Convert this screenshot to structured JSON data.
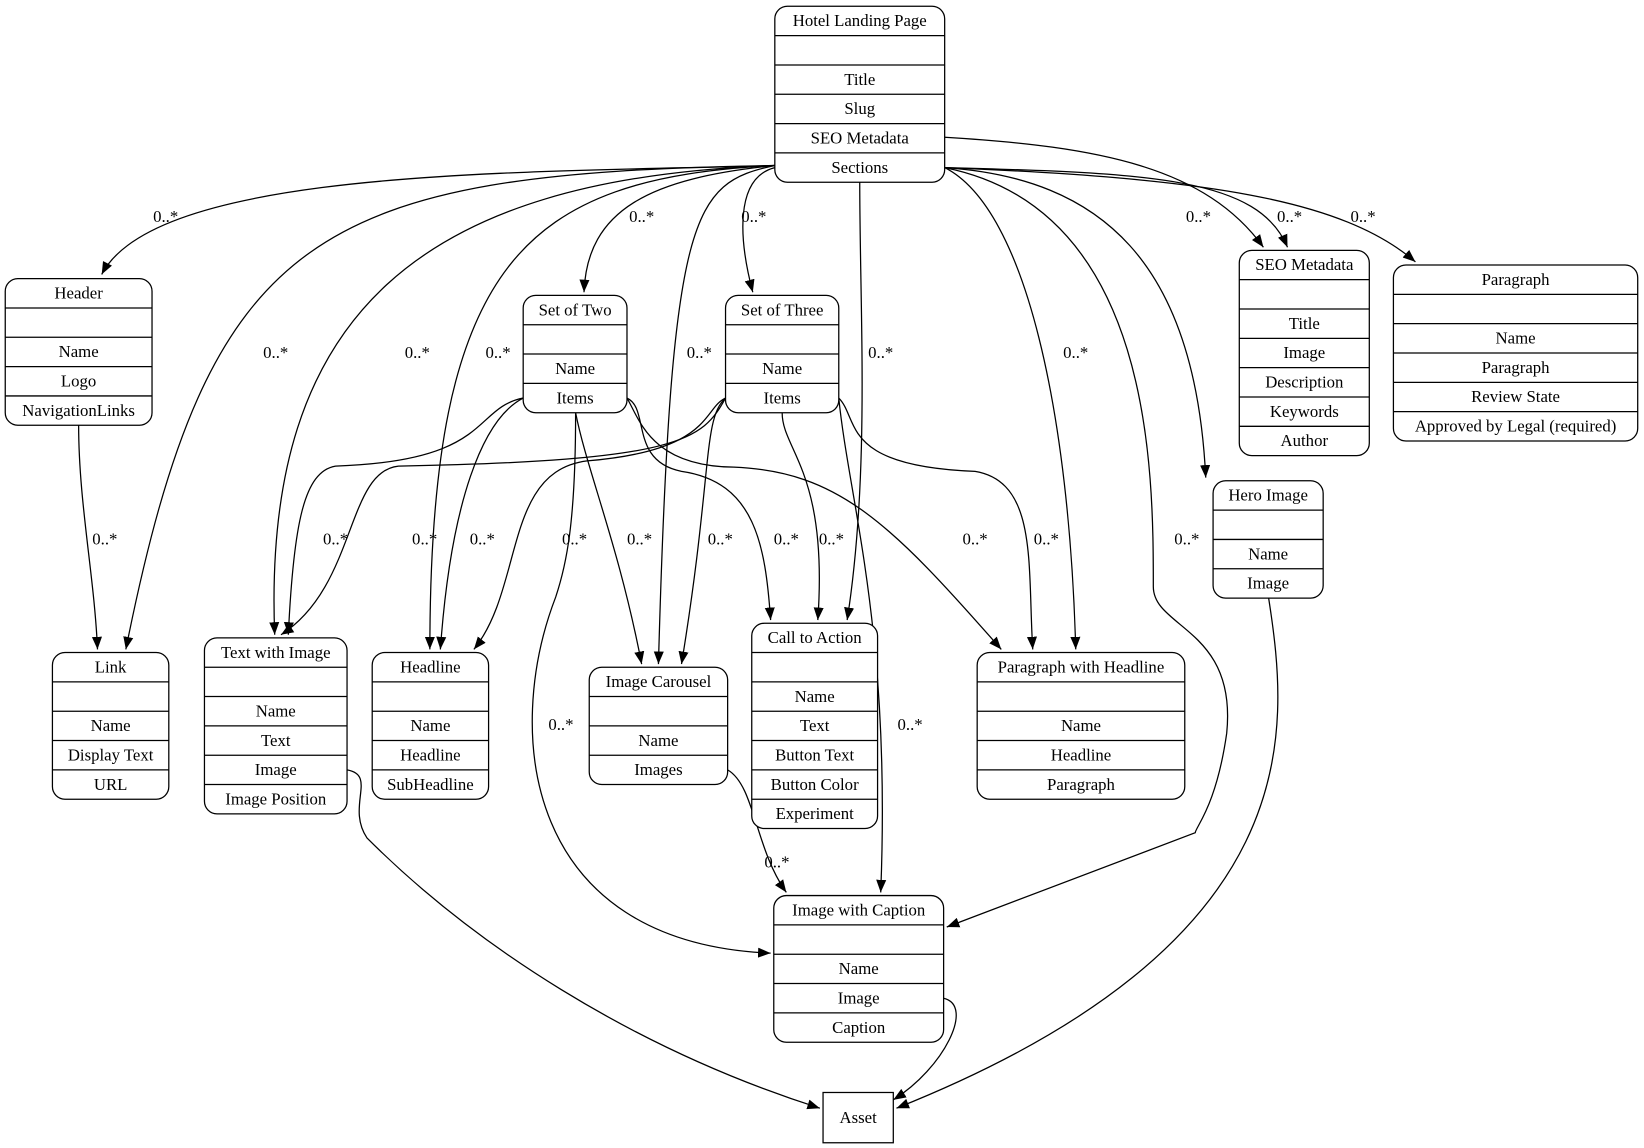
{
  "nodes": [
    {
      "id": "hlp",
      "title": "Hotel Landing Page",
      "fields": [
        "",
        "Title",
        "Slug",
        "SEO Metadata",
        "Sections"
      ]
    },
    {
      "id": "header",
      "title": "Header",
      "fields": [
        "",
        "Name",
        "Logo",
        "NavigationLinks"
      ]
    },
    {
      "id": "settwo",
      "title": "Set of Two",
      "fields": [
        "",
        "Name",
        "Items"
      ]
    },
    {
      "id": "setthree",
      "title": "Set of Three",
      "fields": [
        "",
        "Name",
        "Items"
      ]
    },
    {
      "id": "seo",
      "title": "SEO Metadata",
      "fields": [
        "",
        "Title",
        "Image",
        "Description",
        "Keywords",
        "Author"
      ]
    },
    {
      "id": "paragraph",
      "title": "Paragraph",
      "fields": [
        "",
        "Name",
        "Paragraph",
        "Review State",
        "Approved by Legal (required)"
      ]
    },
    {
      "id": "hero",
      "title": "Hero Image",
      "fields": [
        "",
        "Name",
        "Image"
      ]
    },
    {
      "id": "link",
      "title": "Link",
      "fields": [
        "",
        "Name",
        "Display Text",
        "URL"
      ]
    },
    {
      "id": "twi",
      "title": "Text with Image",
      "fields": [
        "",
        "Name",
        "Text",
        "Image",
        "Image Position"
      ]
    },
    {
      "id": "headline",
      "title": "Headline",
      "fields": [
        "",
        "Name",
        "Headline",
        "SubHeadline"
      ]
    },
    {
      "id": "carousel",
      "title": "Image Carousel",
      "fields": [
        "",
        "Name",
        "Images"
      ]
    },
    {
      "id": "cta",
      "title": "Call to Action",
      "fields": [
        "",
        "Name",
        "Text",
        "Button Text",
        "Button Color",
        "Experiment"
      ]
    },
    {
      "id": "pwh",
      "title": "Paragraph with Headline",
      "fields": [
        "",
        "Name",
        "Headline",
        "Paragraph"
      ]
    },
    {
      "id": "iwc",
      "title": "Image with Caption",
      "fields": [
        "",
        "Name",
        "Image",
        "Caption"
      ]
    },
    {
      "id": "asset",
      "title": "Asset",
      "fields": []
    }
  ],
  "edges": [
    {
      "from": "hlp",
      "to": "header",
      "label": "0..*"
    },
    {
      "from": "hlp",
      "to": "link",
      "label": "0..*"
    },
    {
      "from": "hlp",
      "to": "twi",
      "label": "0..*"
    },
    {
      "from": "hlp",
      "to": "headline",
      "label": "0..*"
    },
    {
      "from": "hlp",
      "to": "settwo",
      "label": "0..*"
    },
    {
      "from": "hlp",
      "to": "carousel",
      "label": "0..*"
    },
    {
      "from": "hlp",
      "to": "setthree",
      "label": "0..*"
    },
    {
      "from": "hlp",
      "to": "cta",
      "label": "0..*"
    },
    {
      "from": "hlp",
      "to": "pwh",
      "label": "0..*"
    },
    {
      "from": "hlp",
      "to": "iwc",
      "label": "0..*"
    },
    {
      "from": "hlp",
      "to": "hero",
      "label": "0..*"
    },
    {
      "from": "hlp",
      "to": "seo",
      "label": ""
    },
    {
      "from": "hlp",
      "to": "seo",
      "label": "0..*"
    },
    {
      "from": "hlp",
      "to": "paragraph",
      "label": "0..*"
    },
    {
      "from": "header",
      "to": "link",
      "label": "0..*"
    },
    {
      "from": "settwo",
      "to": "twi",
      "label": "0..*"
    },
    {
      "from": "settwo",
      "to": "headline",
      "label": "0..*"
    },
    {
      "from": "settwo",
      "to": "iwc",
      "label": "0..*"
    },
    {
      "from": "settwo",
      "to": "carousel",
      "label": "0..*"
    },
    {
      "from": "settwo",
      "to": "cta",
      "label": "0..*"
    },
    {
      "from": "settwo",
      "to": "pwh",
      "label": "0..*"
    },
    {
      "from": "setthree",
      "to": "twi",
      "label": "0..*"
    },
    {
      "from": "setthree",
      "to": "headline",
      "label": "0..*"
    },
    {
      "from": "setthree",
      "to": "carousel",
      "label": "0..*"
    },
    {
      "from": "setthree",
      "to": "cta",
      "label": "0..*"
    },
    {
      "from": "setthree",
      "to": "pwh",
      "label": "0..*"
    },
    {
      "from": "setthree",
      "to": "iwc",
      "label": "0..*"
    },
    {
      "from": "twi",
      "to": "asset",
      "label": ""
    },
    {
      "from": "carousel",
      "to": "iwc",
      "label": "0..*"
    },
    {
      "from": "iwc",
      "to": "asset",
      "label": ""
    },
    {
      "from": "hero",
      "to": "asset",
      "label": ""
    }
  ]
}
